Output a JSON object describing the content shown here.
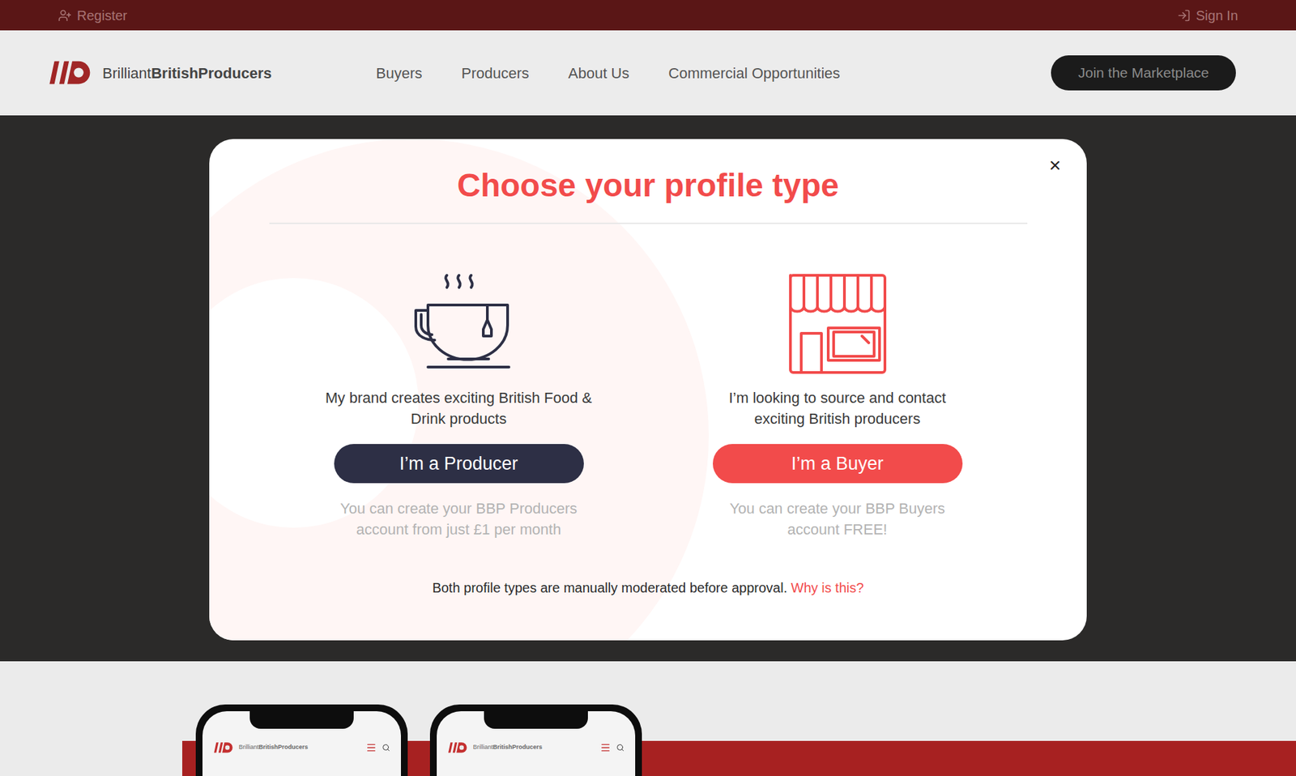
{
  "top_bar": {
    "register": "Register",
    "sign_in": "Sign In"
  },
  "header": {
    "logo": {
      "light": "Brilliant",
      "bold": "BritishProducers"
    },
    "nav": [
      "Buyers",
      "Producers",
      "About Us",
      "Commercial Opportunities"
    ],
    "cta": "Join the Marketplace"
  },
  "modal": {
    "title": "Choose your profile type",
    "close": "×",
    "options": [
      {
        "kind": "cup",
        "description": "My brand creates exciting British Food & Drink products",
        "button": "I’m a Producer",
        "note": "You can create your BBP Producers account from just £1 per month",
        "color": "#2d2f45"
      },
      {
        "kind": "shop",
        "description": "I’m looking to source and contact exciting British producers",
        "button": "I’m a Buyer",
        "note": "You can create your BBP Buyers account FREE!",
        "color": "#f24b4b"
      }
    ],
    "footer": {
      "text": "Both profile types are manually moderated before approval.",
      "link": "Why is this?"
    }
  },
  "phones": [
    {
      "logo_light": "Brilliant",
      "logo_bold": "BritishProducers"
    },
    {
      "logo_light": "Brilliant",
      "logo_bold": "BritishProducers"
    }
  ]
}
